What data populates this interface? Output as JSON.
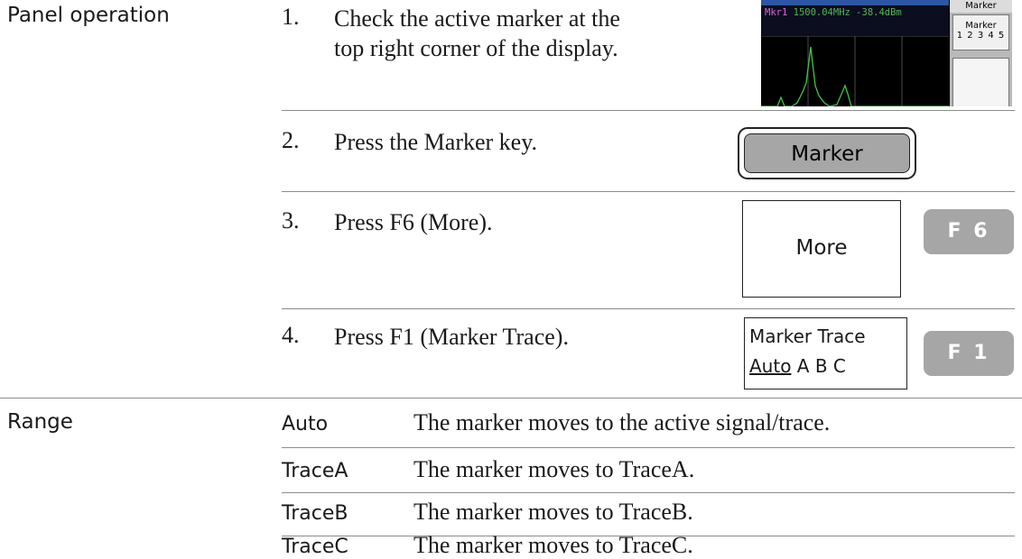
{
  "panel_operation": {
    "label": "Panel operation",
    "steps": [
      {
        "num": "1.",
        "lines": [
          "Check the active marker at the",
          "top right corner of the display."
        ]
      },
      {
        "num": "2.",
        "text": "Press the Marker key."
      },
      {
        "num": "3.",
        "text": "Press F6 (More)."
      },
      {
        "num": "4.",
        "text": "Press F1 (Marker Trace)."
      }
    ]
  },
  "screen": {
    "marker_readout_label": "Mkr1",
    "marker_readout_freq": "1500.04MHz",
    "marker_readout_level": "-38.4dBm",
    "softkey_title": "Marker",
    "softkey_label": "Marker",
    "softkey_numbers": "1 2 3 4 5"
  },
  "keys": {
    "marker_key": "Marker",
    "more_softkey": "More",
    "f6_key": "F 6",
    "marker_trace_softkey_title": "Marker Trace",
    "marker_trace_options_auto": "Auto",
    "marker_trace_options_rest": " A B C",
    "f1_key": "F 1"
  },
  "range": {
    "label": "Range",
    "items": [
      {
        "key": "Auto",
        "desc": "The marker moves to the active signal/trace."
      },
      {
        "key": "TraceA",
        "desc": "The marker moves to TraceA."
      },
      {
        "key": "TraceB",
        "desc": "The marker moves to TraceB."
      },
      {
        "key": "TraceC",
        "desc": "The marker moves to TraceC."
      }
    ]
  }
}
